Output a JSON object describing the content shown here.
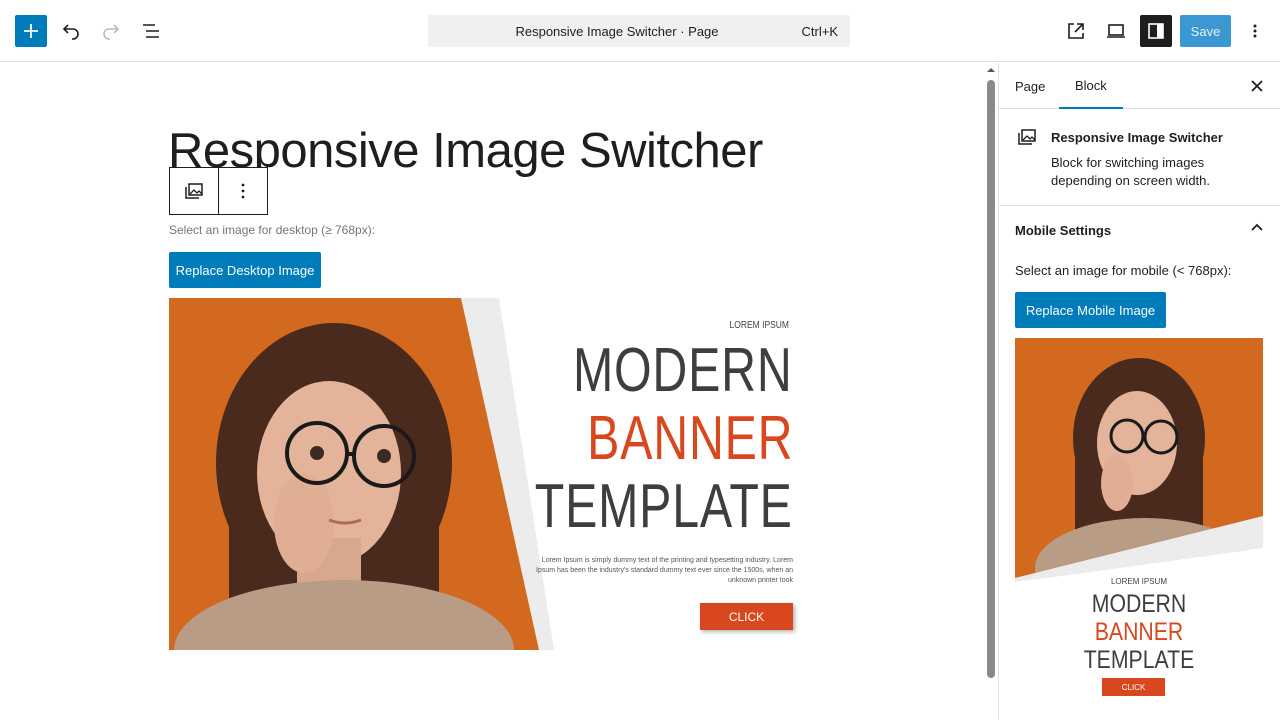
{
  "header": {
    "command_title": "Responsive Image Switcher · Page",
    "shortcut": "Ctrl+K",
    "save_label": "Save"
  },
  "editor": {
    "page_title": "Responsive Image Switcher",
    "desktop_help": "Select an image for desktop (≥ 768px):",
    "replace_desktop_label": "Replace Desktop Image",
    "banner": {
      "kicker": "LOREM IPSUM",
      "line1": "MODERN",
      "line2": "BANNER",
      "line3": "TEMPLATE",
      "body": "Lorem Ipsum is simply dummy text of the printing and typesetting industry. Lorem Ipsum has been the industry's standard dummy text ever since the 1500s, when an unknown printer took",
      "cta": "CLICK"
    }
  },
  "sidebar": {
    "tabs": [
      "Page",
      "Block"
    ],
    "active_tab": "Block",
    "block_title": "Responsive Image Switcher",
    "block_desc": "Block for switching images depending on screen width.",
    "section_title": "Mobile Settings",
    "mobile_help": "Select an image for mobile (< 768px):",
    "replace_mobile_label": "Replace Mobile Image",
    "mobile_banner": {
      "kicker": "LOREM IPSUM",
      "line1": "MODERN",
      "line2": "BANNER",
      "line3": "TEMPLATE",
      "cta": "CLICK"
    }
  },
  "colors": {
    "accent": "#007cba",
    "banner_orange": "#d9471f",
    "photo_bg": "#d2691e"
  }
}
